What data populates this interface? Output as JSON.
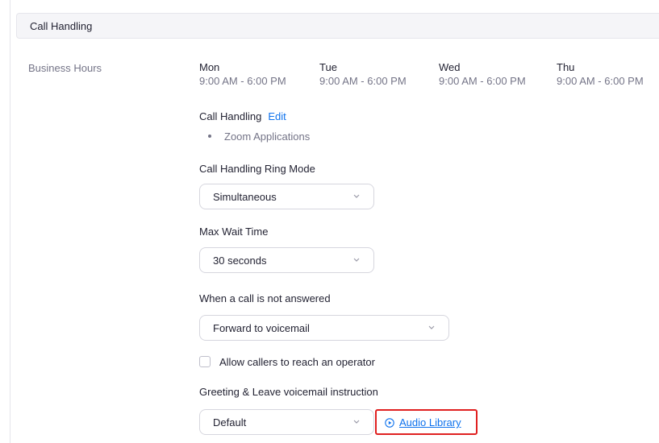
{
  "section": {
    "title": "Call Handling"
  },
  "business_hours": {
    "label": "Business Hours",
    "days": [
      {
        "name": "Mon",
        "time": "9:00 AM - 6:00 PM"
      },
      {
        "name": "Tue",
        "time": "9:00 AM - 6:00 PM"
      },
      {
        "name": "Wed",
        "time": "9:00 AM - 6:00 PM"
      },
      {
        "name": "Thu",
        "time": "9:00 AM - 6:00 PM"
      }
    ]
  },
  "call_handling": {
    "label": "Call Handling",
    "edit_label": "Edit",
    "items": [
      "Zoom Applications"
    ]
  },
  "ring_mode": {
    "label": "Call Handling Ring Mode",
    "value": "Simultaneous"
  },
  "max_wait": {
    "label": "Max Wait Time",
    "value": "30 seconds"
  },
  "not_answered": {
    "label": "When a call is not answered",
    "value": "Forward to voicemail"
  },
  "operator": {
    "label": "Allow callers to reach an operator",
    "checked": false
  },
  "greeting": {
    "label": "Greeting & Leave voicemail instruction",
    "value": "Default",
    "audio_library_label": "Audio Library"
  },
  "icons": {
    "chevron": "chevron-down-icon",
    "play": "play-circle-icon"
  },
  "colors": {
    "link": "#0e72ed",
    "highlight": "#e02020",
    "header_bg": "#f5f5f8"
  }
}
